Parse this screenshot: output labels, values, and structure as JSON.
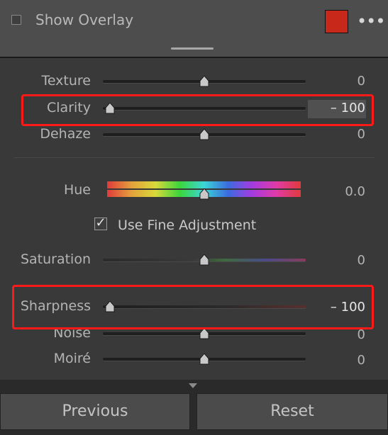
{
  "overlay": {
    "label": "Show Overlay",
    "checked": false,
    "color": "#c8281a",
    "more_icon": "ellipsis-icon",
    "more_glyph": "•••"
  },
  "sliders": [
    {
      "key": "texture",
      "label": "Texture",
      "value": "0",
      "position": 0.5
    },
    {
      "key": "clarity",
      "label": "Clarity",
      "value": "– 100",
      "position": 0.0
    },
    {
      "key": "dehaze",
      "label": "Dehaze",
      "value": "0",
      "position": 0.5
    }
  ],
  "hue": {
    "label": "Hue",
    "value": "0.0",
    "position": 0.5
  },
  "fine_adjustment": {
    "label": "Use Fine Adjustment",
    "checked": true,
    "glyph": "✓"
  },
  "sliders2": [
    {
      "key": "saturation",
      "label": "Saturation",
      "value": "0",
      "position": 0.5
    },
    {
      "key": "sharpness",
      "label": "Sharpness",
      "value": "– 100",
      "position": 0.0
    },
    {
      "key": "noise",
      "label": "Noise",
      "value": "0",
      "position": 0.5
    },
    {
      "key": "moire",
      "label": "Moiré",
      "value": "0",
      "position": 0.5
    }
  ],
  "buttons": {
    "previous": "Previous",
    "reset": "Reset"
  },
  "colors": {
    "highlight": "#ff1a1a"
  }
}
